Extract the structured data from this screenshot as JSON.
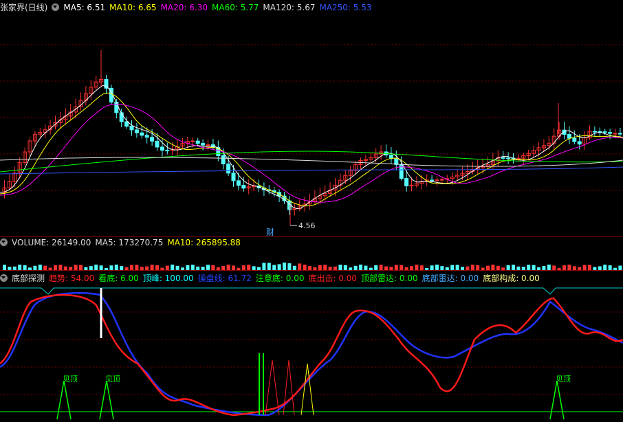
{
  "main_panel": {
    "title": "张家界(日线)",
    "ma_items": [
      {
        "label": "MA5: 6.51",
        "color": "#ffffff"
      },
      {
        "label": "MA10: 6.65",
        "color": "#ffff00"
      },
      {
        "label": "MA20: 6.30",
        "color": "#ff00ff"
      },
      {
        "label": "MA60: 5.77",
        "color": "#00ff00"
      },
      {
        "label": "MA120: 5.67",
        "color": "#dddddd"
      },
      {
        "label": "MA250: 5.53",
        "color": "#3355ff"
      }
    ],
    "low_price_label": "4.56",
    "event_marker": "财"
  },
  "volume_panel": {
    "items": [
      {
        "label": "VOLUME: 26149.00",
        "color": "#dddddd"
      },
      {
        "label": "MA5: 173270.75",
        "color": "#dddddd"
      },
      {
        "label": "MA10: 265895.88",
        "color": "#ffff00"
      }
    ]
  },
  "indicator_panel": {
    "title": "底部探测",
    "items": [
      {
        "label": "趋势: 54.00",
        "color": "#ff2020"
      },
      {
        "label": "看底: 6.00",
        "color": "#00ff00"
      },
      {
        "label": "顶峰: 100.00",
        "color": "#00ffff"
      },
      {
        "label": "操盘线: 61.72",
        "color": "#2244ff"
      },
      {
        "label": "注意底: 0.00",
        "color": "#00ff00"
      },
      {
        "label": "底出击: 0.00",
        "color": "#ff2020"
      },
      {
        "label": "顶部雷达: 0.00",
        "color": "#00ff00"
      },
      {
        "label": "底部雷达: 0.00",
        "color": "#44aaff"
      },
      {
        "label": "底部构成: 0.00",
        "color": "#ffff88"
      }
    ],
    "peak_signal_label": "见顶"
  },
  "colors": {
    "up": "#ff3232",
    "down": "#54ffff",
    "grid": "#8b0000",
    "background": "#000000"
  }
}
